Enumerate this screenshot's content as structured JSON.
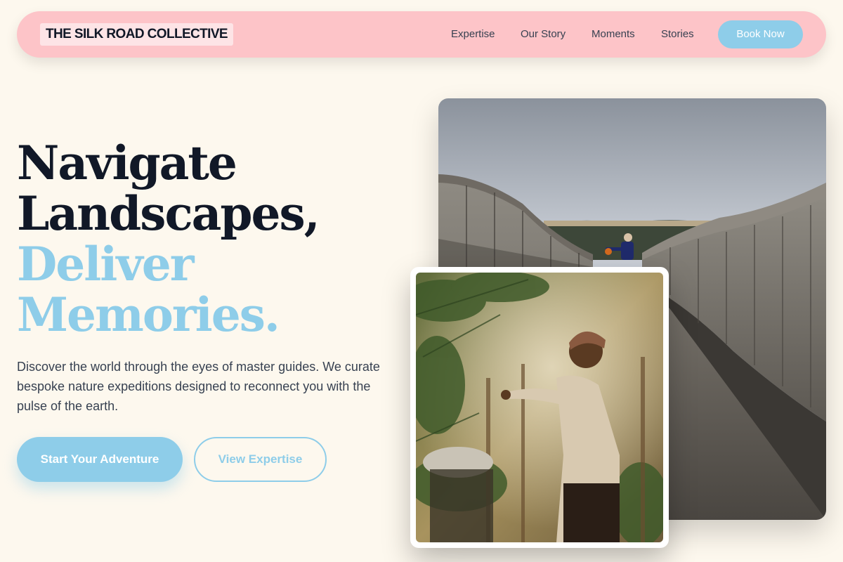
{
  "nav": {
    "brand": "THE SILK ROAD COLLECTIVE",
    "links": [
      "Expertise",
      "Our Story",
      "Moments",
      "Stories"
    ],
    "cta": "Book Now"
  },
  "hero": {
    "headline_dark": [
      "Navigate",
      "Landscapes,"
    ],
    "headline_light": [
      "Deliver",
      "Memories."
    ],
    "lead": "Discover the world through the eyes of master guides. We curate bespoke nature expeditions designed to reconnect you with the pulse of the earth.",
    "primary_button": "Start Your Adventure",
    "secondary_button": "View Expertise"
  },
  "colors": {
    "nav_background": "#fdc4c8",
    "accent": "#8ecde9",
    "page_background": "#fdf8ee",
    "heading": "#111827"
  }
}
